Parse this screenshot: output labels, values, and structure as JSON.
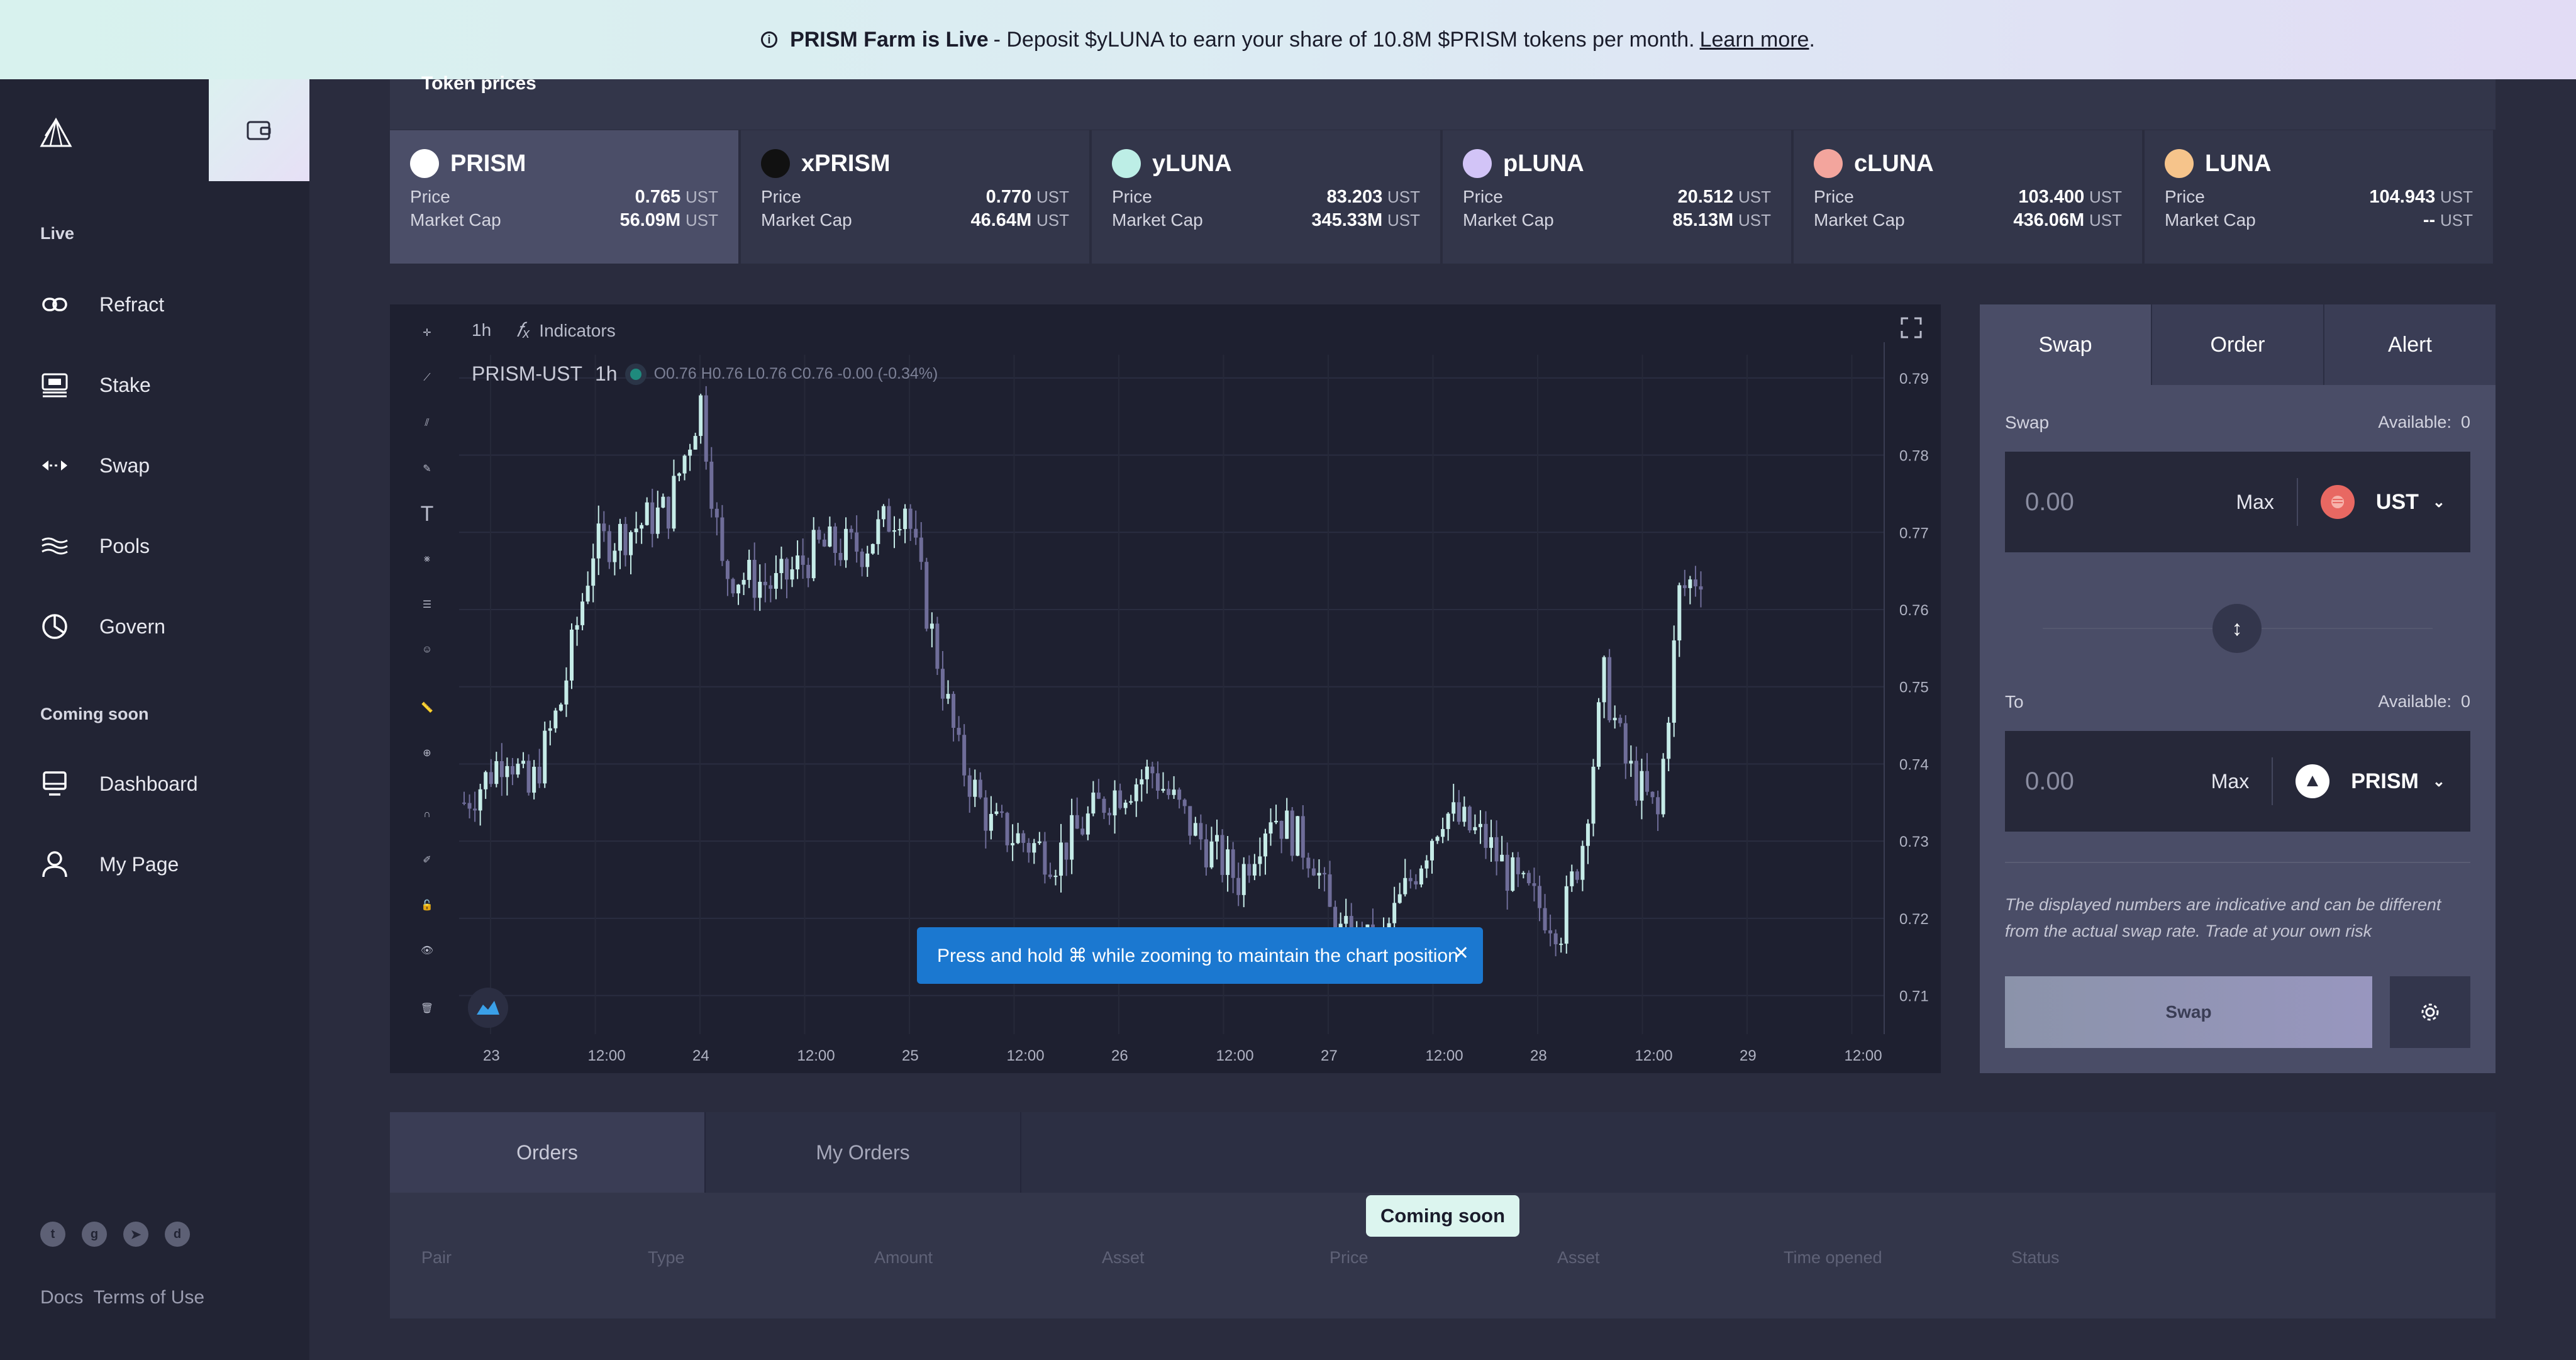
{
  "banner": {
    "title": "PRISM Farm is Live",
    "text": "- Deposit $yLUNA to earn your share of 10.8M $PRISM tokens per month.",
    "link": "Learn more",
    "end": "."
  },
  "sidebar": {
    "section_live": "Live",
    "items_live": [
      {
        "label": "Refract",
        "icon": "link-icon"
      },
      {
        "label": "Stake",
        "icon": "stake-icon"
      },
      {
        "label": "Swap",
        "icon": "swap-arrows-icon"
      },
      {
        "label": "Pools",
        "icon": "waves-icon"
      },
      {
        "label": "Govern",
        "icon": "pie-chart-icon"
      }
    ],
    "section_soon": "Coming soon",
    "items_soon": [
      {
        "label": "Dashboard",
        "icon": "monitor-icon"
      },
      {
        "label": "My Page",
        "icon": "user-icon"
      }
    ],
    "footer": {
      "docs": "Docs",
      "terms": "Terms of Use"
    }
  },
  "prices": {
    "title": "Token prices",
    "price_label": "Price",
    "cap_label": "Market Cap",
    "unit": "UST",
    "tokens": [
      {
        "name": "PRISM",
        "price": "0.765",
        "cap": "56.09M",
        "color": "#ffffff"
      },
      {
        "name": "xPRISM",
        "price": "0.770",
        "cap": "46.64M",
        "color": "#111111"
      },
      {
        "name": "yLUNA",
        "price": "83.203",
        "cap": "345.33M",
        "color": "#bdeee6"
      },
      {
        "name": "pLUNA",
        "price": "20.512",
        "cap": "85.13M",
        "color": "#d2c4f7"
      },
      {
        "name": "cLUNA",
        "price": "103.400",
        "cap": "436.06M",
        "color": "#f3a59d"
      },
      {
        "name": "LUNA",
        "price": "104.943",
        "cap": "--",
        "color": "#f6c48b"
      }
    ]
  },
  "chart": {
    "interval": "1h",
    "indicators": "Indicators",
    "symbol": "PRISM-UST",
    "symbol_interval": "1h",
    "ohlc": {
      "o": "0.76",
      "h": "0.76",
      "l": "0.76",
      "c": "0.76",
      "chg": "-0.00 (-0.34%)"
    },
    "toast": "Press and hold ⌘ while zooming to maintain the chart position"
  },
  "chart_data": {
    "type": "candlestick",
    "pair": "PRISM-UST",
    "interval": "1h",
    "ylim": [
      0.705,
      0.793
    ],
    "yticks": [
      "0.79",
      "0.78",
      "0.77",
      "0.76",
      "0.75",
      "0.74",
      "0.73",
      "0.72",
      "0.71"
    ],
    "xticks": [
      "23",
      "12:00",
      "24",
      "12:00",
      "25",
      "12:00",
      "26",
      "12:00",
      "27",
      "12:00",
      "28",
      "12:00",
      "29",
      "12:00"
    ],
    "colors": {
      "up": "#c6ece8",
      "down": "#6f6d99"
    }
  },
  "swap": {
    "tabs": [
      "Swap",
      "Order",
      "Alert"
    ],
    "from_label": "Swap",
    "to_label": "To",
    "available_label": "Available:",
    "from_available": "0",
    "to_available": "0",
    "placeholder": "0.00",
    "max": "Max",
    "from_asset": "UST",
    "to_asset": "PRISM",
    "disclaimer": "The displayed numbers are indicative and can be different from the actual swap rate. Trade at your own risk",
    "button": "Swap"
  },
  "orders": {
    "tabs": [
      "Orders",
      "My Orders"
    ],
    "coming_soon": "Coming soon",
    "columns": [
      "Pair",
      "Type",
      "Amount",
      "Asset",
      "Price",
      "Asset",
      "Time opened",
      "Status"
    ]
  }
}
